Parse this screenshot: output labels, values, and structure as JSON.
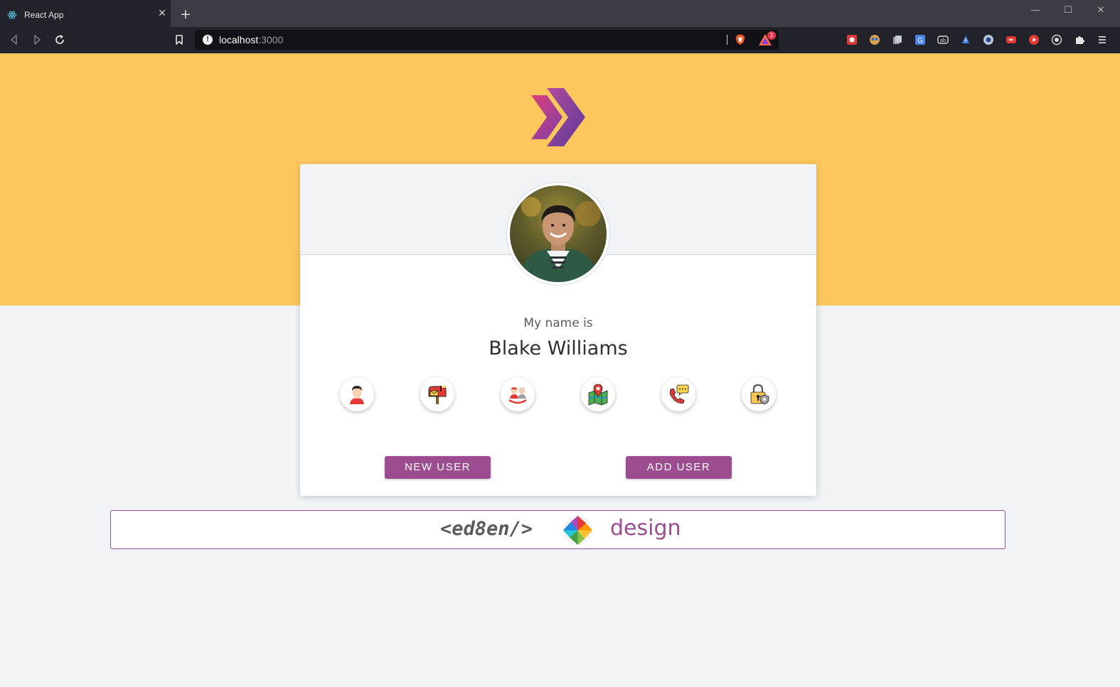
{
  "browser": {
    "tab_title": "React App",
    "tab_close": "✕",
    "new_tab": "+",
    "url_host": "localhost",
    "url_port": ":3000",
    "rewards_count": "1",
    "window_controls": {
      "minimize": "—",
      "maximize": "☐",
      "close": "✕"
    }
  },
  "colors": {
    "hero": "#fdc75e",
    "accent": "#9b4d8f",
    "page_bg": "#f1f4f7"
  },
  "card": {
    "label": "My name is",
    "value": "Blake Williams",
    "icons": [
      "user-icon",
      "mailbox-icon",
      "age-icon",
      "map-location-icon",
      "phone-icon",
      "password-lock-icon"
    ],
    "buttons": {
      "new_user": "NEW USER",
      "add_user": "ADD USER"
    }
  },
  "footer": {
    "code_text": "<ed8en/>",
    "design_text": "design"
  }
}
